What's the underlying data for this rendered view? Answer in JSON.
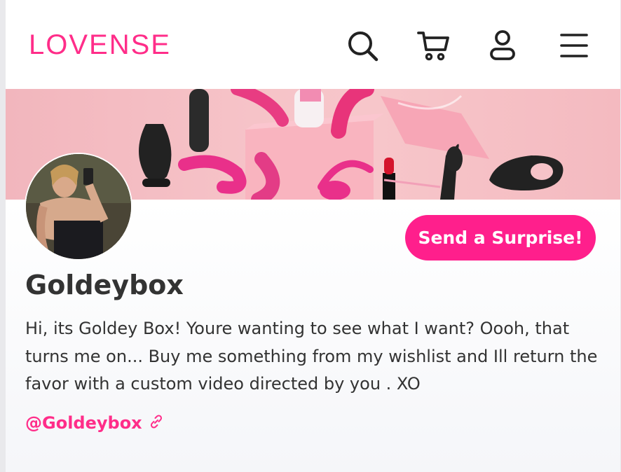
{
  "header": {
    "logo_text": "LOVENSE",
    "icons": [
      "search-icon",
      "cart-icon",
      "user-icon",
      "menu-icon"
    ]
  },
  "profile": {
    "name": "Goldeybox",
    "bio": "Hi, its Goldey Box! Youre wanting to see what I want? Oooh, that turns me on... Buy me something from my wishlist and Ill return the favor with a custom video directed by you . XO",
    "handle": "@Goldeybox",
    "cta_label": "Send a Surprise!"
  },
  "colors": {
    "brand": "#ff2d89",
    "cta_bg": "#ff1f8c",
    "text": "#333333",
    "banner_bg": "#f6c3c8"
  }
}
